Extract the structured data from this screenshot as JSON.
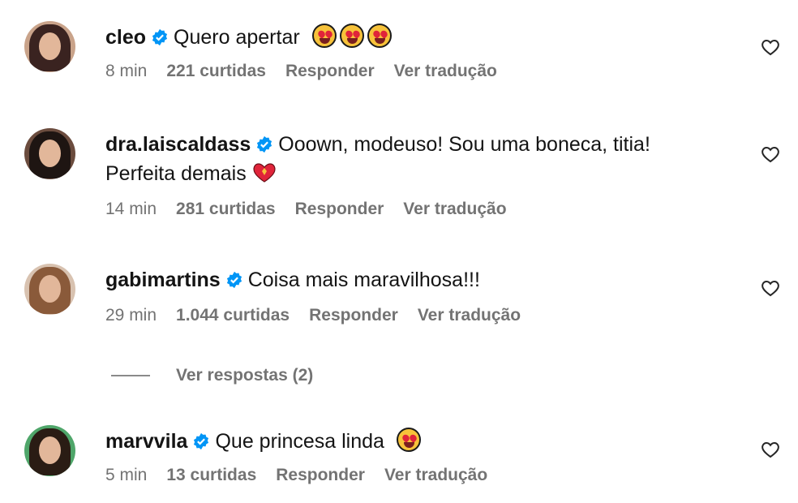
{
  "comments": [
    {
      "username": "cleo",
      "text": "Quero apertar",
      "text_line2": "",
      "time": "8 min",
      "likes": "221 curtidas",
      "reply": "Responder",
      "translate": "Ver tradução",
      "avatar_colors": {
        "hair": "#3a2320",
        "bg": "#c9a38a"
      }
    },
    {
      "username": "dra.laiscaldass",
      "text": "Ooown, modeuso! Sou uma boneca, titia!",
      "text_line2": "Perfeita demais",
      "time": "14 min",
      "likes": "281 curtidas",
      "reply": "Responder",
      "translate": "Ver tradução",
      "avatar_colors": {
        "hair": "#1e1512",
        "bg": "#6b4c3e"
      }
    },
    {
      "username": "gabimartins",
      "text": "Coisa mais maravilhosa!!!",
      "text_line2": "",
      "time": "29 min",
      "likes": "1.044 curtidas",
      "reply": "Responder",
      "translate": "Ver tradução",
      "avatar_colors": {
        "hair": "#8a5a3a",
        "bg": "#d8c2b0"
      }
    },
    {
      "username": "marvvila",
      "text": "Que princesa linda",
      "text_line2": "",
      "time": "5 min",
      "likes": "13 curtidas",
      "reply": "Responder",
      "translate": "Ver tradução",
      "avatar_colors": {
        "hair": "#2a1c14",
        "bg": "#4fa66a"
      }
    }
  ],
  "view_replies": "Ver respostas (2)",
  "icons": {
    "verified": "verified-badge-icon",
    "like": "heart-outline-icon"
  },
  "colors": {
    "verified_blue": "#0095f6",
    "meta_gray": "#737373",
    "text": "#141414"
  }
}
